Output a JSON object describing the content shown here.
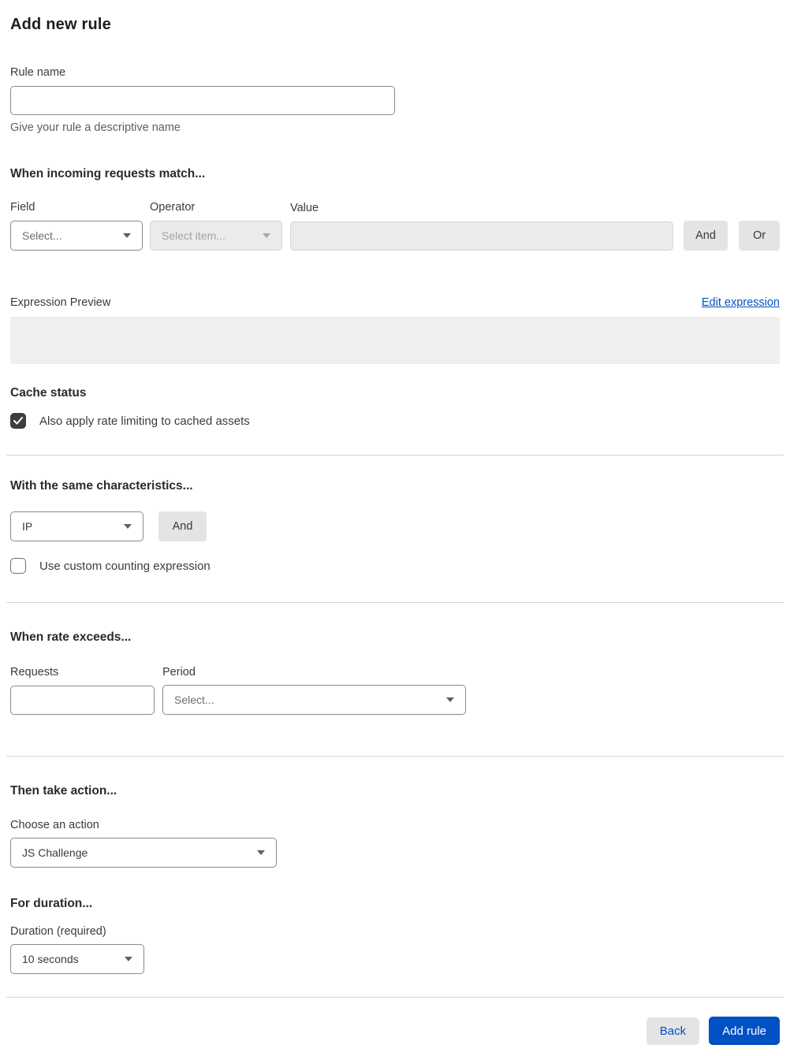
{
  "page": {
    "title": "Add new rule"
  },
  "rule_name": {
    "label": "Rule name",
    "value": "",
    "helper": "Give your rule a descriptive name"
  },
  "match": {
    "heading": "When incoming requests match...",
    "field_label": "Field",
    "field_value": "Select...",
    "operator_label": "Operator",
    "operator_value": "Select item...",
    "value_label": "Value",
    "value_value": "",
    "and_label": "And",
    "or_label": "Or"
  },
  "expression": {
    "label": "Expression Preview",
    "edit_link": "Edit expression",
    "value": ""
  },
  "cache": {
    "heading": "Cache status",
    "checkbox_label": "Also apply rate limiting to cached assets",
    "checked": true
  },
  "characteristics": {
    "heading": "With the same characteristics...",
    "select_value": "IP",
    "and_label": "And",
    "checkbox_label": "Use custom counting expression",
    "checked": false
  },
  "rate": {
    "heading": "When rate exceeds...",
    "requests_label": "Requests",
    "requests_value": "",
    "period_label": "Period",
    "period_value": "Select..."
  },
  "action": {
    "heading": "Then take action...",
    "label": "Choose an action",
    "value": "JS Challenge"
  },
  "duration": {
    "heading": "For duration...",
    "label": "Duration (required)",
    "value": "10 seconds"
  },
  "footer": {
    "back_label": "Back",
    "submit_label": "Add rule"
  },
  "colors": {
    "accent_blue": "#0051c3",
    "disabled_bg": "#ebebeb",
    "button_gray": "#e4e4e4",
    "checkbox_dark": "#3d3d3d"
  }
}
